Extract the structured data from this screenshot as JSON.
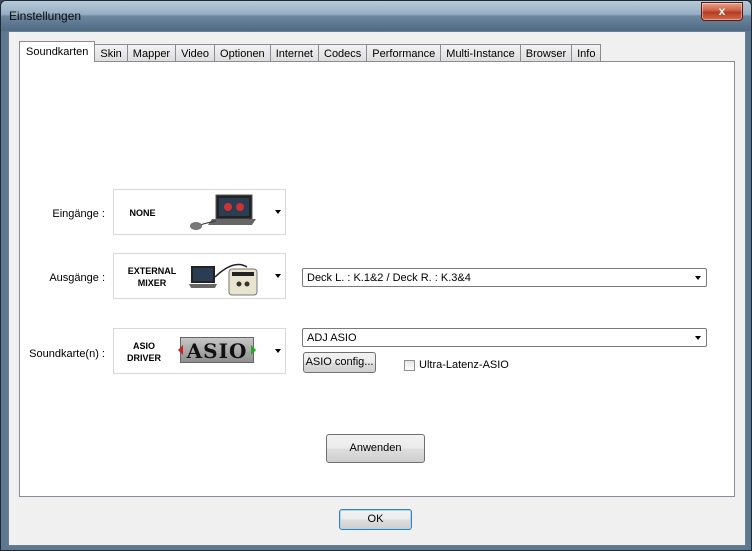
{
  "window": {
    "title": "Einstellungen",
    "close_glyph": "x"
  },
  "tabs": [
    {
      "label": "Soundkarten",
      "active": true
    },
    {
      "label": "Skin"
    },
    {
      "label": "Mapper"
    },
    {
      "label": "Video"
    },
    {
      "label": "Optionen"
    },
    {
      "label": "Internet"
    },
    {
      "label": "Codecs"
    },
    {
      "label": "Performance"
    },
    {
      "label": "Multi-Instance"
    },
    {
      "label": "Browser"
    },
    {
      "label": "Info"
    }
  ],
  "inputs_row": {
    "label": "Eingänge :",
    "device_line1": "NONE"
  },
  "outputs_row": {
    "label": "Ausgänge :",
    "device_line1": "EXTERNAL",
    "device_line2": "MIXER",
    "routing": "Deck L. : K.1&2 / Deck R. : K.3&4"
  },
  "soundcard_row": {
    "label": "Soundkarte(n) :",
    "device_line1": "ASIO",
    "device_line2": "DRIVER",
    "logo_text": "ASIO",
    "driver": "ADJ ASIO",
    "config_button": "ASIO config...",
    "low_latency_label": "Ultra-Latenz-ASIO",
    "low_latency_checked": false
  },
  "apply_button": "Anwenden",
  "ok_button": "OK"
}
